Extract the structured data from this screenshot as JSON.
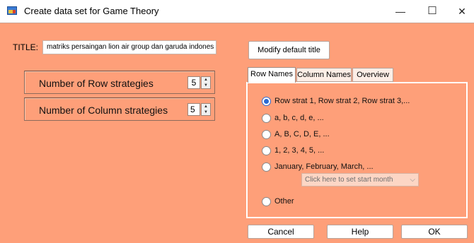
{
  "window": {
    "title": "Create data set for Game Theory",
    "minimize": "—",
    "maximize": "☐",
    "close": "✕"
  },
  "title_field": {
    "label": "TITLE:",
    "value": "matriks persaingan lion air group dan garuda indones"
  },
  "modify_title_button": "Modify default title",
  "strategies": {
    "rows_label": "Number of Row strategies",
    "rows_value": "5",
    "cols_label": "Number of Column strategies",
    "cols_value": "5"
  },
  "tabs": [
    "Row Names",
    "Column Names",
    "Overview"
  ],
  "active_tab": "Row Names",
  "row_name_options": [
    {
      "label": "Row strat 1, Row strat 2, Row strat 3,...",
      "selected": true
    },
    {
      "label": "a, b, c, d, e, ...",
      "selected": false
    },
    {
      "label": "A, B, C, D, E, ...",
      "selected": false
    },
    {
      "label": "1, 2, 3, 4, 5, ...",
      "selected": false
    },
    {
      "label": "January, February, March, ...",
      "selected": false
    },
    {
      "label": "Other",
      "selected": false
    }
  ],
  "start_month_select": "Click here to set start month",
  "buttons": {
    "cancel": "Cancel",
    "help": "Help",
    "ok": "OK"
  },
  "colors": {
    "background": "#fe9f79",
    "accent": "#2b6ad3"
  }
}
